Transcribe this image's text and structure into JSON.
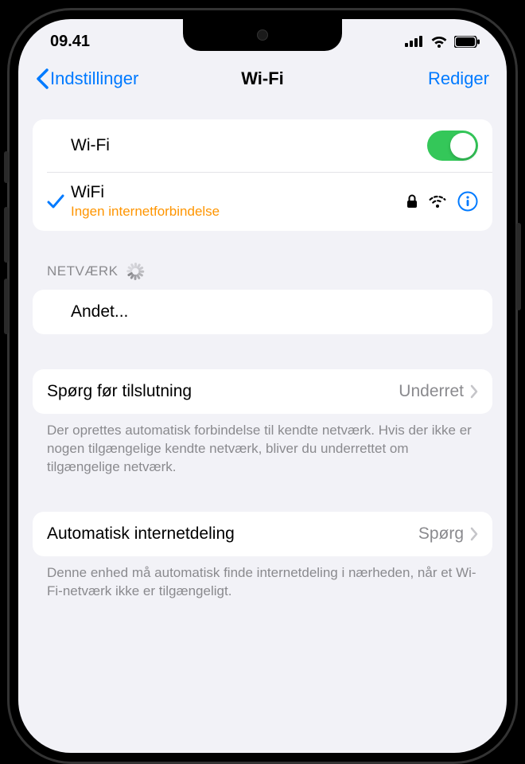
{
  "status": {
    "time": "09.41"
  },
  "nav": {
    "back": "Indstillinger",
    "title": "Wi-Fi",
    "edit": "Rediger"
  },
  "wifi": {
    "toggle_label": "Wi-Fi",
    "toggle_on": true,
    "connected": {
      "name": "WiFi",
      "status": "Ingen internetforbindelse",
      "secured": true
    }
  },
  "networks": {
    "header": "NETVÆRK",
    "other": "Andet..."
  },
  "ask": {
    "label": "Spørg før tilslutning",
    "value": "Underret",
    "footer": "Der oprettes automatisk forbindelse til kendte netværk. Hvis der ikke er nogen tilgængelige kendte netværk, bliver du underrettet om tilgængelige netværk."
  },
  "hotspot": {
    "label": "Automatisk internetdeling",
    "value": "Spørg",
    "footer": "Denne enhed må automatisk finde internetdeling i nærheden, når et Wi-Fi-netværk ikke er tilgængeligt."
  }
}
